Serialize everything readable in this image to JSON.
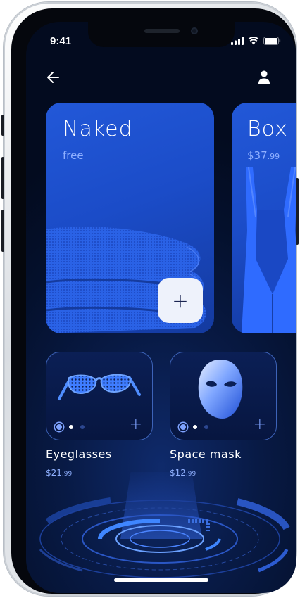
{
  "status_bar": {
    "time": "9:41"
  },
  "nav": {
    "back_icon": "arrow-left-icon",
    "profile_icon": "user-icon"
  },
  "featured": [
    {
      "title": "Naked",
      "price": "free",
      "price_cents": "",
      "image": "folded-fabric",
      "add_label": "+"
    },
    {
      "title": "Box",
      "price": "$37",
      "price_cents": ".99",
      "image": "bib-shorts"
    }
  ],
  "products": [
    {
      "name": "Eyeglasses",
      "price": "$21",
      "price_cents": ".99",
      "image": "eyeglasses",
      "add_label": "+"
    },
    {
      "name": "Space mask",
      "price": "$12",
      "price_cents": ".99",
      "image": "space-mask",
      "add_label": "+"
    }
  ],
  "colors": {
    "background": "#04102c",
    "card": "#1b4cc8",
    "accent": "#7fa3ff",
    "price": "#8fb0ff"
  }
}
